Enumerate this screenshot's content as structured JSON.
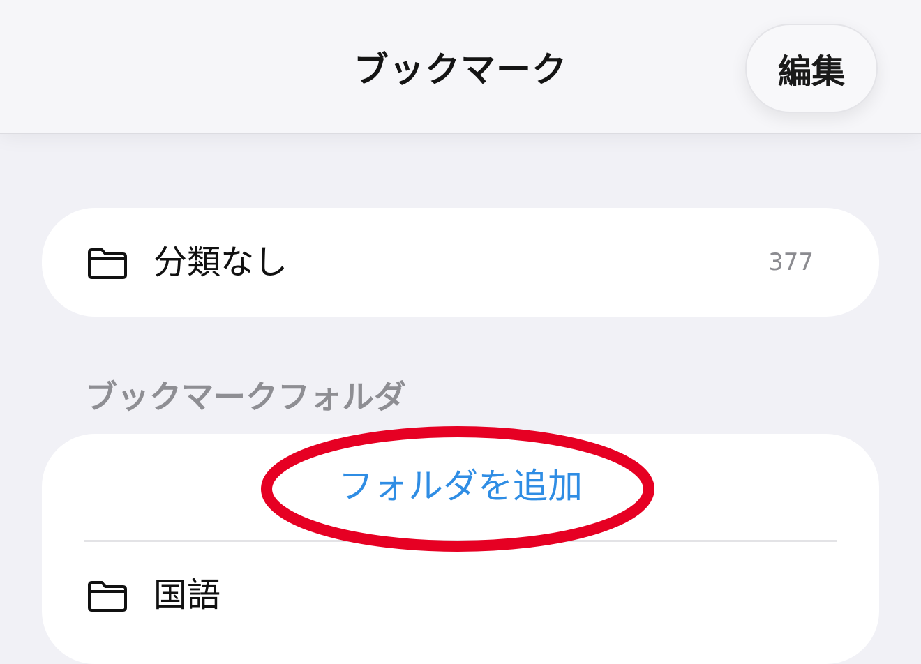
{
  "header": {
    "title": "ブックマーク",
    "edit_label": "編集"
  },
  "uncategorized": {
    "label": "分類なし",
    "count": "377",
    "icon": "folder-icon"
  },
  "folders_section": {
    "title": "ブックマークフォルダ",
    "add_folder_label": "フォルダを追加",
    "items": [
      {
        "label": "国語",
        "icon": "folder-icon"
      }
    ]
  },
  "colors": {
    "accent": "#2f8de4",
    "highlight": "#e60023",
    "background": "#f1f1f6"
  }
}
